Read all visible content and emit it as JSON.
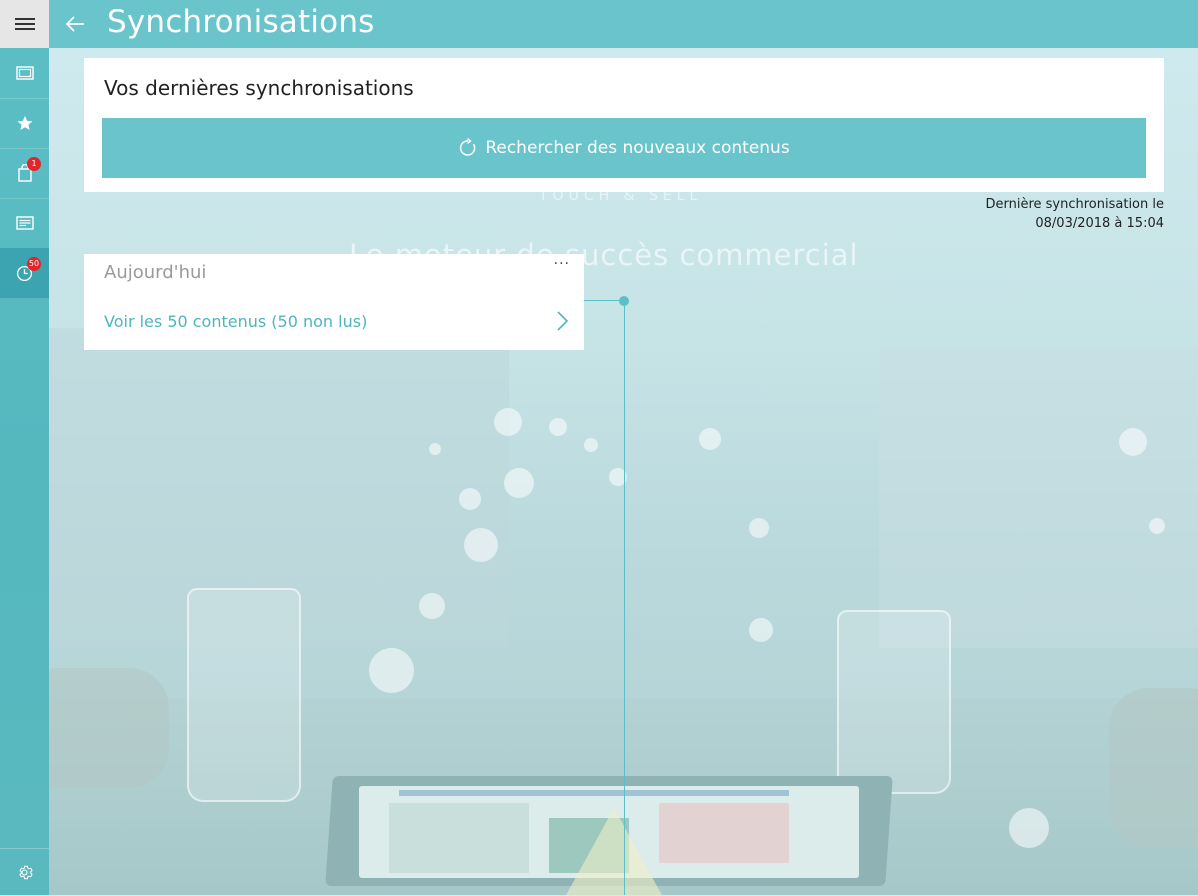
{
  "window": {
    "title": "Synchronisations"
  },
  "header": {
    "title": "Synchronisations",
    "back_icon": "back-arrow-icon"
  },
  "sidebar": {
    "menu_icon": "hamburger-icon",
    "items": [
      {
        "id": "contents",
        "icon": "slides-icon",
        "badge": ""
      },
      {
        "id": "favorites",
        "icon": "star-icon",
        "badge": ""
      },
      {
        "id": "basket",
        "icon": "bag-icon",
        "badge": "1"
      },
      {
        "id": "news",
        "icon": "newspaper-icon",
        "badge": ""
      },
      {
        "id": "history",
        "icon": "clock-icon",
        "badge": "50",
        "active": true
      }
    ],
    "settings_icon": "gear-icon"
  },
  "sync_panel": {
    "heading": "Vos dernières synchronisations",
    "search_button_label": "Rechercher des nouveaux contenus",
    "last_sync_line1": "Dernière synchronisation le",
    "last_sync_line2": "08/03/2018 à 15:04"
  },
  "timeline": {
    "entries": [
      {
        "label": "Aujourd'hui",
        "link_text": "Voir les 50 contenus (50 non lus)",
        "more": "···"
      }
    ]
  },
  "background": {
    "faint_line1": "TOUCH & SELL",
    "faint_line2": "Le moteur de succès commercial"
  },
  "colors": {
    "accent": "#69c4cb",
    "badge": "#e0252b",
    "link": "#4db5bf"
  }
}
